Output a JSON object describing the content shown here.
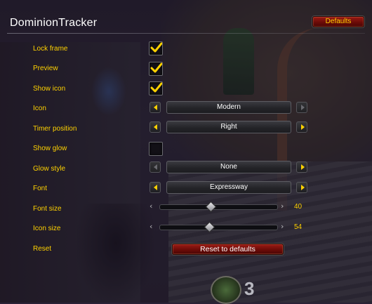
{
  "title": "DominionTracker",
  "defaults_label": "Defaults",
  "settings": {
    "lock_frame": {
      "label": "Lock frame",
      "checked": true
    },
    "preview": {
      "label": "Preview",
      "checked": true
    },
    "show_icon": {
      "label": "Show icon",
      "checked": true
    },
    "icon": {
      "label": "Icon",
      "value": "Modern"
    },
    "timer_position": {
      "label": "Timer position",
      "value": "Right"
    },
    "show_glow": {
      "label": "Show glow",
      "checked": false
    },
    "glow_style": {
      "label": "Glow style",
      "value": "None"
    },
    "font": {
      "label": "Font",
      "value": "Expressway"
    },
    "font_size": {
      "label": "Font size",
      "value": "40",
      "fraction": 0.43
    },
    "icon_size": {
      "label": "Icon size",
      "value": "54",
      "fraction": 0.42
    },
    "reset": {
      "label": "Reset",
      "button_label": "Reset to defaults"
    }
  },
  "action_bar_count": "3",
  "icons": {
    "check": "checkmark-icon",
    "prev": "chevron-left-icon",
    "next": "chevron-right-icon"
  },
  "colors": {
    "label": "#ffd200",
    "button_red": "#7a0f0a",
    "text": "#ffffff"
  }
}
